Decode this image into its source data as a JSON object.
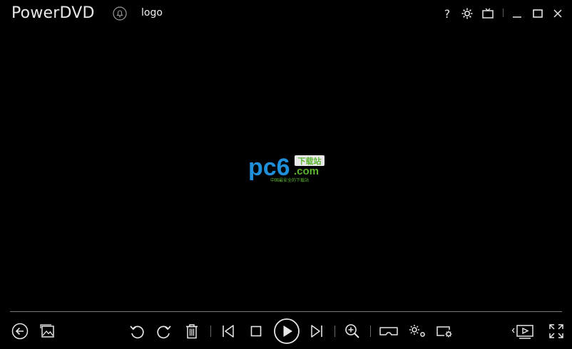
{
  "app": {
    "title": "PowerDVD",
    "logo_label": "logo"
  },
  "window_controls": {
    "help": "?",
    "icons": [
      "help-icon",
      "settings-icon",
      "tv-mode-icon",
      "minimize-icon",
      "maximize-icon",
      "close-icon"
    ]
  },
  "center_logo": {
    "main": "pc6",
    "badge": "下载站",
    "domain": ".com",
    "tagline": "中国最安全的下载站",
    "colors": {
      "blue": "#1e8fd8",
      "green": "#5cb531",
      "badge_bg": "#e8e8e8"
    }
  },
  "controls": {
    "left": [
      "back-icon",
      "image-icon"
    ],
    "middle": [
      "rotate-left-icon",
      "rotate-right-icon",
      "delete-icon",
      "previous-icon",
      "stop-icon",
      "play-icon",
      "next-icon",
      "zoom-in-icon",
      "vr-headset-icon",
      "effects-settings-icon",
      "slideshow-settings-icon"
    ],
    "right": [
      "playlist-icon",
      "fullscreen-icon"
    ]
  },
  "colors": {
    "background": "#000000",
    "foreground": "#e6e6e6",
    "divider": "#7a7a7a"
  }
}
